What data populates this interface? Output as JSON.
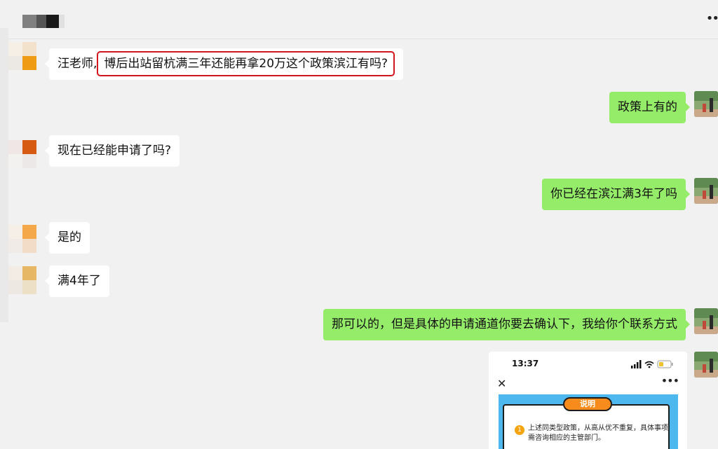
{
  "header": {
    "more_icon": "more-dots-icon"
  },
  "messages": [
    {
      "sender": "other",
      "prefix": "汪老师,",
      "text": "博后出站留杭满三年还能再拿20万这个政策滨江有吗?"
    },
    {
      "sender": "me",
      "text": "政策上有的"
    },
    {
      "sender": "other",
      "text": "现在已经能申请了吗?"
    },
    {
      "sender": "me",
      "text": "你已经在滨江满3年了吗"
    },
    {
      "sender": "other",
      "text": "是的"
    },
    {
      "sender": "other",
      "text": "满4年了"
    },
    {
      "sender": "me",
      "text": "那可以的，但是具体的申请通道你要去确认下，我给你个联系方式"
    }
  ],
  "screenshot_card": {
    "time": "13:37",
    "close_icon": "close-icon",
    "more_icon": "more-dots-icon",
    "tab_label": "说明",
    "badge": "1",
    "body": "上述同类型政策，从高从优不重复，具体事项需咨询相应的主管部门。"
  },
  "colors": {
    "out_bubble": "#95ec69",
    "in_bubble": "#ffffff",
    "highlight_border": "#d2161c",
    "background": "#f1f1f1"
  }
}
